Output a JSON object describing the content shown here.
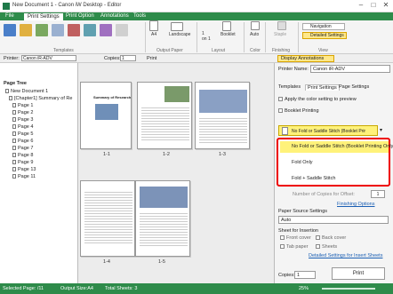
{
  "window": {
    "title": "New Document 1 - Canon iW Desktop - Editor",
    "min": "–",
    "max": "□",
    "close": "✕"
  },
  "menu": {
    "items": [
      "File",
      "Print Settings",
      "Print Option",
      "Annotations",
      "Tools"
    ]
  },
  "ribbon": {
    "templates_label": "Templates",
    "output_paper_label": "Output Paper",
    "layout_label": "Layout",
    "color_label": "Color",
    "finishing_label": "Finishing",
    "view_label": "View",
    "paper_size": "A4",
    "orientation": "Landscape",
    "pages_per_sheet": "1\non 1",
    "booklet": "Booklet",
    "color_mode": "Auto",
    "staple": "Staple",
    "navigation": "Navigation",
    "detailed_settings": "Detailed Settings"
  },
  "toolbar2": {
    "printer_label": "Printer:",
    "printer_value": "Canon iR-ADV",
    "copies_label": "Copies:",
    "copies_value": "1",
    "print_btn": "Print",
    "display_annotations": "Display Annotations"
  },
  "tree": {
    "header": "Page Tree",
    "root": "New Document 1",
    "chapter": "[Chapter1] Summary of Re",
    "pages": [
      "Page 1",
      "Page 2",
      "Page 3",
      "Page 4",
      "Page 5",
      "Page 6",
      "Page 7",
      "Page 8",
      "Page 9",
      "Page 13",
      "Page 11"
    ]
  },
  "pages": {
    "labels": [
      "1-1",
      "1-2",
      "1-3",
      "1-4",
      "1-5"
    ],
    "doc_title": "Summary of Research"
  },
  "panel": {
    "printer_name_label": "Printer Name:",
    "printer_name_value": "Canon iR-ADV",
    "tabs": [
      "Templates",
      "Print Settings",
      "Page Settings"
    ],
    "apply_color": "Apply the color setting to preview",
    "booklet_printing": "Booklet Printing",
    "current_option": "No Fold or Saddle Stitch (Booklet Prir",
    "options": [
      "No Fold or Saddle Stitch (Booklet Printing Only)",
      "Fold Only",
      "Fold + Saddle Stitch"
    ],
    "copies_offset_label": "Number of Copies for Offset:",
    "copies_offset_value": "1",
    "finishing_options": "Finishing Options",
    "paper_source_label": "Paper Source Settings",
    "paper_source_value": "Auto",
    "sheet_insertion": "Sheet for Insertion",
    "front_cover": "Front cover",
    "back_cover": "Back cover",
    "tab_paper": "Tab paper",
    "sheets": "Sheets",
    "detailed_insert": "Detailed Settings for Insert Sheets",
    "copies_label": "Copies:",
    "copies_value": "1",
    "print_btn": "Print"
  },
  "status": {
    "selected": "Selected Page: /11",
    "output": "Output Size:A4",
    "total": "Total Sheets: 3",
    "zoom": "25%"
  }
}
